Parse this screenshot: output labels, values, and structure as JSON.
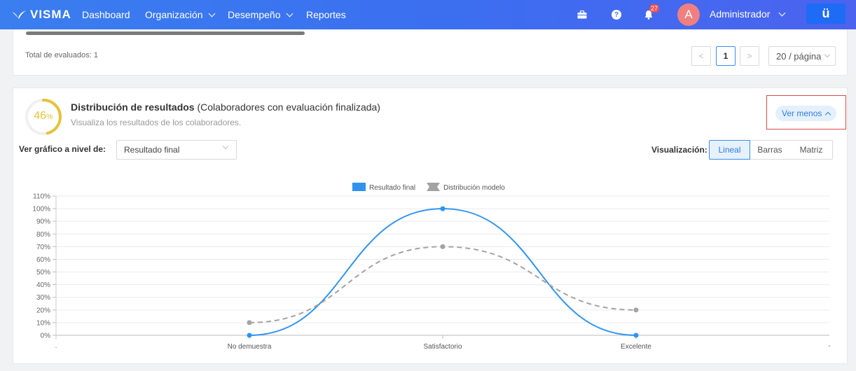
{
  "topbar": {
    "logo": "VISMA",
    "nav": [
      {
        "label": "Dashboard",
        "has_menu": false
      },
      {
        "label": "Organización",
        "has_menu": true
      },
      {
        "label": "Desempeño",
        "has_menu": true
      },
      {
        "label": "Reportes",
        "has_menu": false
      }
    ],
    "notification_count": "27",
    "avatar_initial": "A",
    "user_name": "Administrador",
    "app_button": "ü",
    "icons": [
      "briefcase-icon",
      "help-icon",
      "bell-icon"
    ]
  },
  "results_card": {
    "total_label": "Total de evaluados: 1",
    "pagination": {
      "prev": "<",
      "current_page": "1",
      "next": ">",
      "page_size": "20 / página"
    }
  },
  "distribution_card": {
    "gauge_value": "46",
    "gauge_unit": "%",
    "gauge_fraction": 0.46,
    "gauge_color": "#e6c23a",
    "title_bold": "Distribución de resultados",
    "title_rest": " (Colaboradores con evaluación finalizada)",
    "subtitle": "Visualiza los resultados de los colaboradores.",
    "toggle_label": "Ver menos",
    "level_label": "Ver gráfico a nivel de:",
    "level_value": "Resultado final",
    "visualization_label": "Visualización:",
    "visualization_options": [
      "Lineal",
      "Barras",
      "Matriz"
    ],
    "visualization_selected": "Lineal"
  },
  "chart_data": {
    "type": "line",
    "categories": [
      "No demuestra",
      "Satisfactorio",
      "Excelente"
    ],
    "x_edge_labels": [
      ".",
      "-"
    ],
    "yticks": [
      "0%",
      "10%",
      "20%",
      "30%",
      "40%",
      "50%",
      "60%",
      "70%",
      "80%",
      "90%",
      "100%",
      "110%"
    ],
    "ylim": [
      0,
      110
    ],
    "grid": true,
    "legend_position": "top-center",
    "series": [
      {
        "name": "Resultado final",
        "values": [
          0,
          100,
          0
        ],
        "color": "#2f93ef",
        "style": "solid"
      },
      {
        "name": "Distribución modelo",
        "values": [
          10,
          70,
          20
        ],
        "color": "#a3a3a3",
        "style": "dashed"
      }
    ]
  }
}
